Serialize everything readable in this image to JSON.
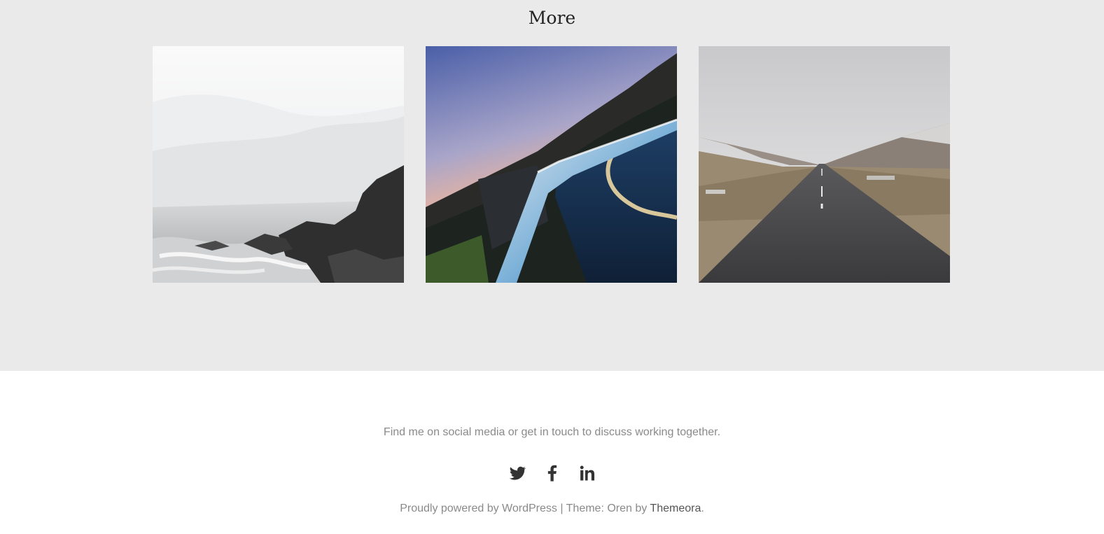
{
  "more": {
    "title": "More"
  },
  "footer": {
    "tagline": "Find me on social media or get in touch to discuss working together.",
    "social": [
      {
        "icon": "twitter-icon"
      },
      {
        "icon": "facebook-icon"
      },
      {
        "icon": "linkedin-icon"
      }
    ],
    "credits": {
      "powered_by": "Proudly powered by WordPress",
      "separator": " | ",
      "theme_text": "Theme: Oren by ",
      "theme_author": "Themeora",
      "period": "."
    }
  },
  "colors": {
    "section_background": "#eaeaea",
    "footer_background": "#ffffff",
    "muted_text": "#8a8a8a",
    "icon": "#333333"
  }
}
